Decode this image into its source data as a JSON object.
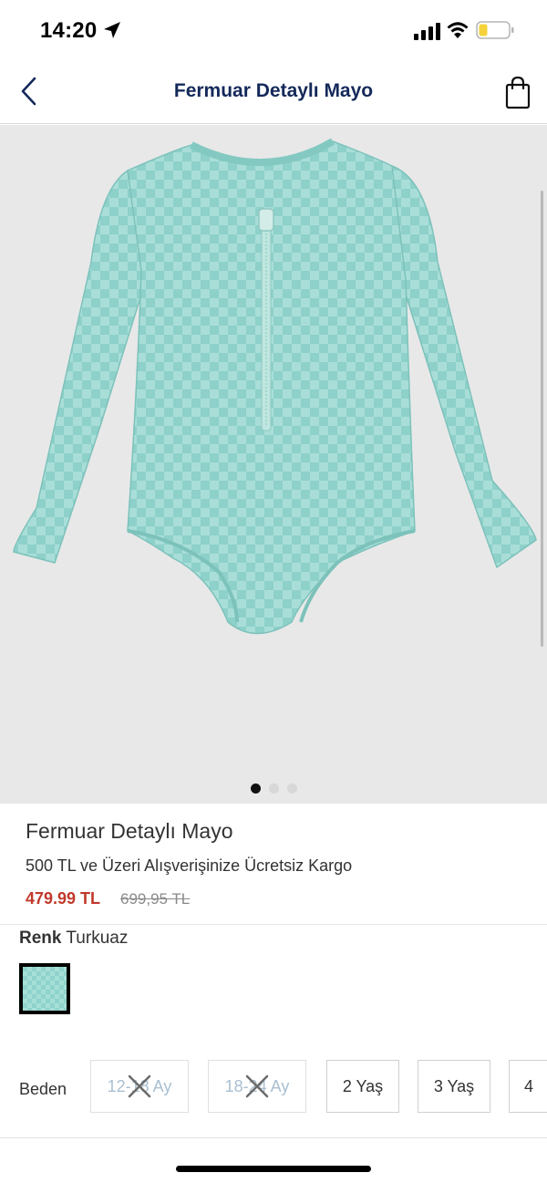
{
  "status_bar": {
    "time": "14:20",
    "icons": [
      "location-arrow-icon",
      "cellular-signal-icon",
      "wifi-icon",
      "battery-low-icon"
    ],
    "battery_color": "#f5d23c"
  },
  "nav": {
    "title": "Fermuar Detaylı Mayo",
    "back_icon": "chevron-left-icon",
    "bag_icon": "shopping-bag-icon",
    "accent_color": "#14295a"
  },
  "gallery": {
    "image": "turquoise checkered long-sleeve zip swimsuit",
    "page_count": 3,
    "active_page": 1
  },
  "product": {
    "title": "Fermuar Detaylı Mayo",
    "shipping_note": "500 TL ve Üzeri Alışverişinize Ücretsiz Kargo",
    "price": "479.99 TL",
    "old_price": "699,95 TL",
    "price_color": "#c0392b"
  },
  "color": {
    "label": "Renk",
    "value": "Turkuaz",
    "swatch_color": "#8fd3cc"
  },
  "size": {
    "label": "Beden",
    "options": [
      {
        "label": "12-18 Ay",
        "available": false
      },
      {
        "label": "18-24 Ay",
        "available": false
      },
      {
        "label": "2 Yaş",
        "available": true
      },
      {
        "label": "3 Yaş",
        "available": true
      },
      {
        "label": "4",
        "available": true
      }
    ]
  }
}
